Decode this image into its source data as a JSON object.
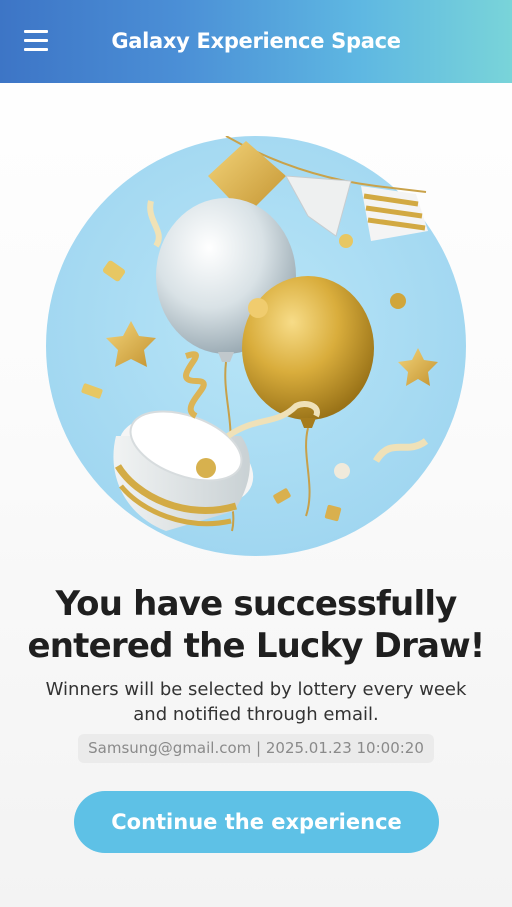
{
  "header": {
    "title": "Galaxy Experience Space",
    "menu_icon": "hamburger-menu-icon"
  },
  "hero": {
    "illustration": "balloons-celebration-illustration"
  },
  "message": {
    "headline_line1": "You have successfully",
    "headline_line2": "entered the Lucky Draw!",
    "sub_line1": "Winners will be selected by lottery every week",
    "sub_line2": "and notified through email.",
    "entry_info": "Samsung@gmail.com | 2025.01.23 10:00:20"
  },
  "actions": {
    "continue_label": "Continue the experience"
  },
  "colors": {
    "header_start": "#3d75c6",
    "header_end": "#79d4d9",
    "hero_circle": "#a9dcf3",
    "cta": "#5ec1e6"
  }
}
